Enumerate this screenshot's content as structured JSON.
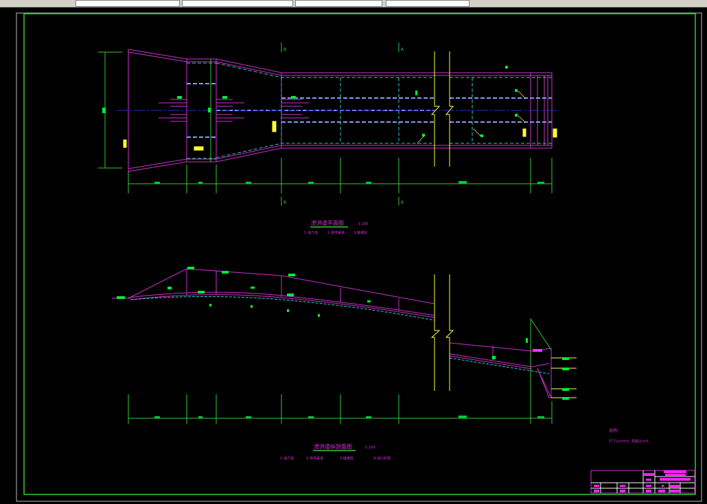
{
  "toolbar": {
    "layer_field": "",
    "color_field": "",
    "linetype_field": "",
    "lineweight_field": ""
  },
  "drawing": {
    "colors": {
      "background": "#000000",
      "frame": "#33cc33",
      "outline": "#cc33cc",
      "hidden": "#33cccc",
      "centerline": "#2233cc",
      "break": "#ffff33",
      "label": "#00ff33"
    },
    "section_marks": {
      "b": "B",
      "a": "A"
    },
    "plan": {
      "title": "泄洪道平面图",
      "scale": "1:100",
      "legend": [
        "1-消力池",
        "2-泄洪渠道",
        "3-陡坡段"
      ]
    },
    "profile": {
      "title": "泄洪道纵剖面图",
      "scale": "1:100",
      "legend": [
        "1-消力池",
        "2-泄洪渠道",
        "3-陡坡段",
        "4-出口护坦"
      ]
    },
    "notes": {
      "heading": "说明:",
      "line": "尺寸以mm计, 高程以m计。"
    }
  }
}
